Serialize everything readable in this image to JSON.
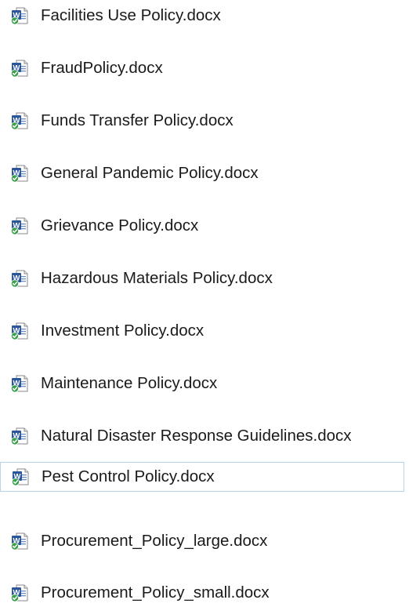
{
  "files": [
    {
      "name": "Facilities Use Policy.docx",
      "icon": "word-document-synced-icon",
      "focused": false
    },
    {
      "name": "FraudPolicy.docx",
      "icon": "word-document-synced-icon",
      "focused": false
    },
    {
      "name": "Funds Transfer Policy.docx",
      "icon": "word-document-synced-icon",
      "focused": false
    },
    {
      "name": "General Pandemic Policy.docx",
      "icon": "word-document-synced-icon",
      "focused": false
    },
    {
      "name": "Grievance Policy.docx",
      "icon": "word-document-synced-icon",
      "focused": false
    },
    {
      "name": "Hazardous Materials Policy.docx",
      "icon": "word-document-synced-icon",
      "focused": false
    },
    {
      "name": "Investment Policy.docx",
      "icon": "word-document-synced-icon",
      "focused": false
    },
    {
      "name": "Maintenance Policy.docx",
      "icon": "word-document-synced-icon",
      "focused": false
    },
    {
      "name": "Natural Disaster Response Guidelines.docx",
      "icon": "word-document-synced-icon",
      "focused": false
    },
    {
      "name": "Pest Control Policy.docx",
      "icon": "word-document-synced-icon",
      "focused": true
    },
    {
      "name": "Procurement_Policy_large.docx",
      "icon": "word-document-synced-icon",
      "focused": false
    },
    {
      "name": "Procurement_Policy_small.docx",
      "icon": "word-document-synced-icon",
      "focused": false
    }
  ],
  "colors": {
    "word_blue": "#2b579a",
    "synced_green": "#3aa14a",
    "focus_border": "#b9d4ea",
    "text": "#1a1a1a"
  }
}
